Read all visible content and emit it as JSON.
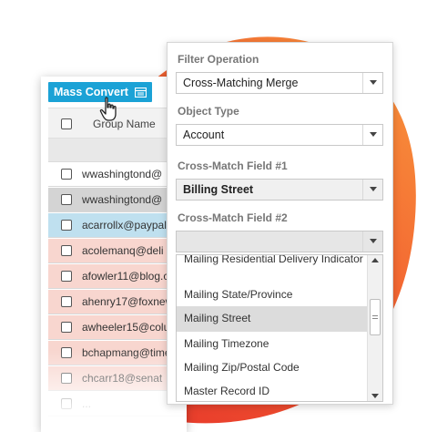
{
  "toolbar": {
    "mass_convert_label": "Mass Convert"
  },
  "table": {
    "header": {
      "group_name": "Group Name"
    },
    "rows": [
      {
        "text": "wwashingtond@",
        "highlight": "none"
      },
      {
        "text": "wwashingtond@",
        "highlight": "gray"
      },
      {
        "text": "acarrollx@paypal",
        "highlight": "blue"
      },
      {
        "text": "acolemanq@deli",
        "highlight": "pink"
      },
      {
        "text": "afowler11@blog.c",
        "highlight": "pink"
      },
      {
        "text": "ahenry17@foxnew",
        "highlight": "pink"
      },
      {
        "text": "awheeler15@colu",
        "highlight": "pink"
      },
      {
        "text": "bchapmang@time",
        "highlight": "pink"
      },
      {
        "text": "chcarr18@senat",
        "highlight": "pink"
      },
      {
        "text": "...",
        "highlight": "none"
      }
    ]
  },
  "filter": {
    "filter_operation": {
      "label": "Filter Operation",
      "value": "Cross-Matching Merge"
    },
    "object_type": {
      "label": "Object Type",
      "value": "Account"
    },
    "cross_match_1": {
      "label": "Cross-Match Field #1",
      "value": "Billing Street"
    },
    "cross_match_2": {
      "label": "Cross-Match Field #2",
      "value": ""
    },
    "options": [
      "Mailing Residential Delivery Indicator",
      "Mailing State/Province",
      "Mailing Street",
      "Mailing Timezone",
      "Mailing Zip/Postal Code",
      "Master Record ID"
    ],
    "selected_option": "Mailing Street"
  },
  "colors": {
    "accent": "#1ba2d6",
    "blob_orange": "#f7803a",
    "blob_red": "#e5322d",
    "row_blue": "#bfe0ef",
    "row_pink": "#f8d6cf",
    "row_gray": "#d4d4d4"
  },
  "icons": [
    "convert-icon",
    "hand-cursor-icon",
    "chevron-down-icon",
    "chevron-up-icon",
    "scroll-grip-icon"
  ]
}
